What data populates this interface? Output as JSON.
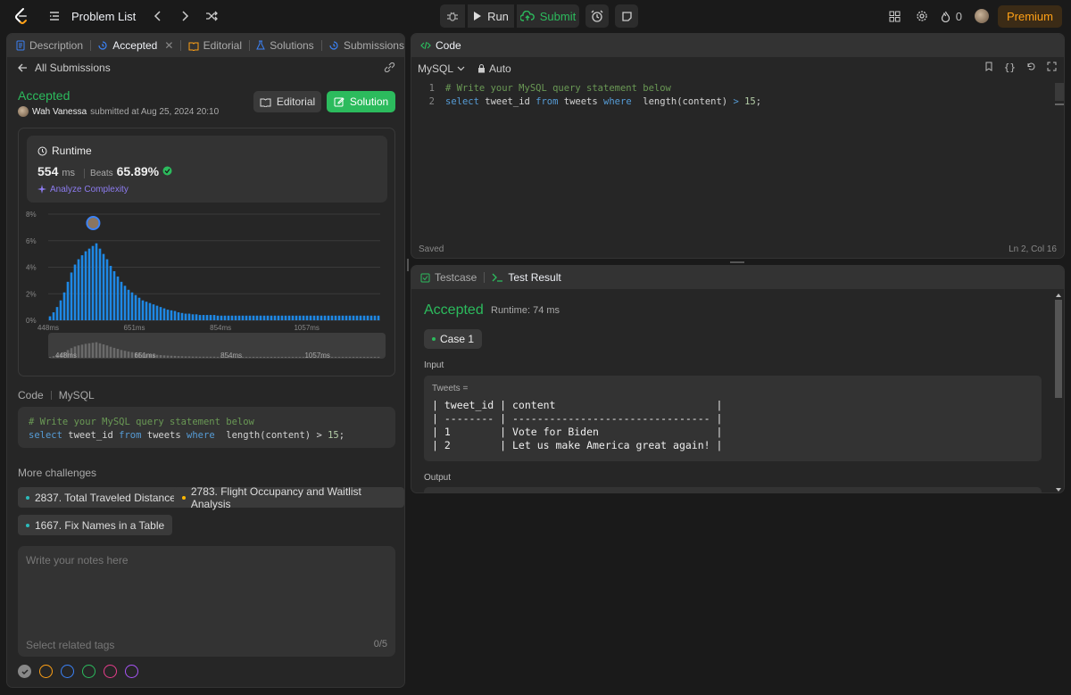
{
  "topbar": {
    "problem_list": "Problem List",
    "run_label": "Run",
    "submit_label": "Submit",
    "streak": "0",
    "premium": "Premium"
  },
  "left_tabs": {
    "description": "Description",
    "accepted": "Accepted",
    "editorial": "Editorial",
    "solutions": "Solutions",
    "submissions": "Submissions"
  },
  "submission": {
    "back_label": "All Submissions",
    "status": "Accepted",
    "user": "Wah Vanessa",
    "submitted_text": "submitted at Aug 25, 2024 20:10",
    "editorial_btn": "Editorial",
    "solution_btn": "Solution"
  },
  "runtime": {
    "title": "Runtime",
    "value": "554",
    "unit": "ms",
    "beats_label": "Beats",
    "beats_pct": "65.89%",
    "analyze": "Analyze Complexity"
  },
  "chart_data": {
    "type": "bar",
    "ylabel": "",
    "xlabel": "",
    "yticks": [
      "8%",
      "6%",
      "4%",
      "2%",
      "0%"
    ],
    "ylim": [
      0,
      8
    ],
    "xticks": [
      "448ms",
      "651ms",
      "854ms",
      "1057ms"
    ],
    "x_range_ms": [
      448,
      1230
    ],
    "highlight_x_ms": 554,
    "values": [
      0.3,
      0.6,
      1.0,
      1.5,
      2.1,
      2.9,
      3.6,
      4.2,
      4.6,
      4.9,
      5.2,
      5.4,
      5.6,
      5.8,
      5.4,
      5.0,
      4.6,
      4.1,
      3.7,
      3.3,
      2.9,
      2.6,
      2.3,
      2.1,
      1.9,
      1.7,
      1.5,
      1.4,
      1.3,
      1.2,
      1.1,
      1.0,
      0.9,
      0.8,
      0.75,
      0.7,
      0.6,
      0.55,
      0.5,
      0.5,
      0.45,
      0.45,
      0.4,
      0.4,
      0.4,
      0.4,
      0.4,
      0.35,
      0.35,
      0.35,
      0.35,
      0.35,
      0.35,
      0.35,
      0.35,
      0.35,
      0.35,
      0.35,
      0.35,
      0.35,
      0.35,
      0.35,
      0.35,
      0.35,
      0.35,
      0.35,
      0.35,
      0.35,
      0.35,
      0.35,
      0.35,
      0.35,
      0.35,
      0.35,
      0.35,
      0.35,
      0.35,
      0.35,
      0.35,
      0.35,
      0.35,
      0.35,
      0.35,
      0.35,
      0.35,
      0.35,
      0.35,
      0.35,
      0.35,
      0.35,
      0.35,
      0.35,
      0.35
    ],
    "mini_xticks": [
      "448ms",
      "651ms",
      "854ms",
      "1057ms"
    ]
  },
  "code": {
    "label": "Code",
    "lang": "MySQL",
    "line1": "# Write your MySQL query statement below",
    "line2_kw1": "select",
    "line2_a": " tweet_id ",
    "line2_kw2": "from",
    "line2_b": " tweets ",
    "line2_kw3": "where",
    "line2_c": "  length(content) ",
    "line2_op": ">",
    "line2_num": "15",
    "line2_end": ";"
  },
  "more": {
    "title": "More challenges",
    "chips": [
      {
        "label": "2837. Total Traveled Distance",
        "color": "#2cbbbb"
      },
      {
        "label": "2783. Flight Occupancy and Waitlist Analysis",
        "color": "#ffb800"
      },
      {
        "label": "1667. Fix Names in a Table",
        "color": "#2cbbbb"
      }
    ]
  },
  "notes": {
    "placeholder": "Write your notes here",
    "tags_placeholder": "Select related tags",
    "tags_count": "0/5"
  },
  "editor": {
    "title": "Code",
    "language": "MySQL",
    "mode": "Auto",
    "saved": "Saved",
    "position": "Ln 2, Col 16",
    "line_numbers": [
      "1",
      "2"
    ]
  },
  "testpanel": {
    "testcase_tab": "Testcase",
    "result_tab": "Test Result",
    "status": "Accepted",
    "runtime": "Runtime: 74 ms",
    "case": "Case 1",
    "input_label": "Input",
    "tweets_label": "Tweets =",
    "table_rows": [
      "| tweet_id | content                          |",
      "| -------- | -------------------------------- |",
      "| 1        | Vote for Biden                   |",
      "| 2        | Let us make America great again! |"
    ],
    "output_label": "Output"
  },
  "colors": {
    "accent_green": "#2cbb5d",
    "premium": "#ffa116",
    "bar_blue": "#1e88e5"
  }
}
